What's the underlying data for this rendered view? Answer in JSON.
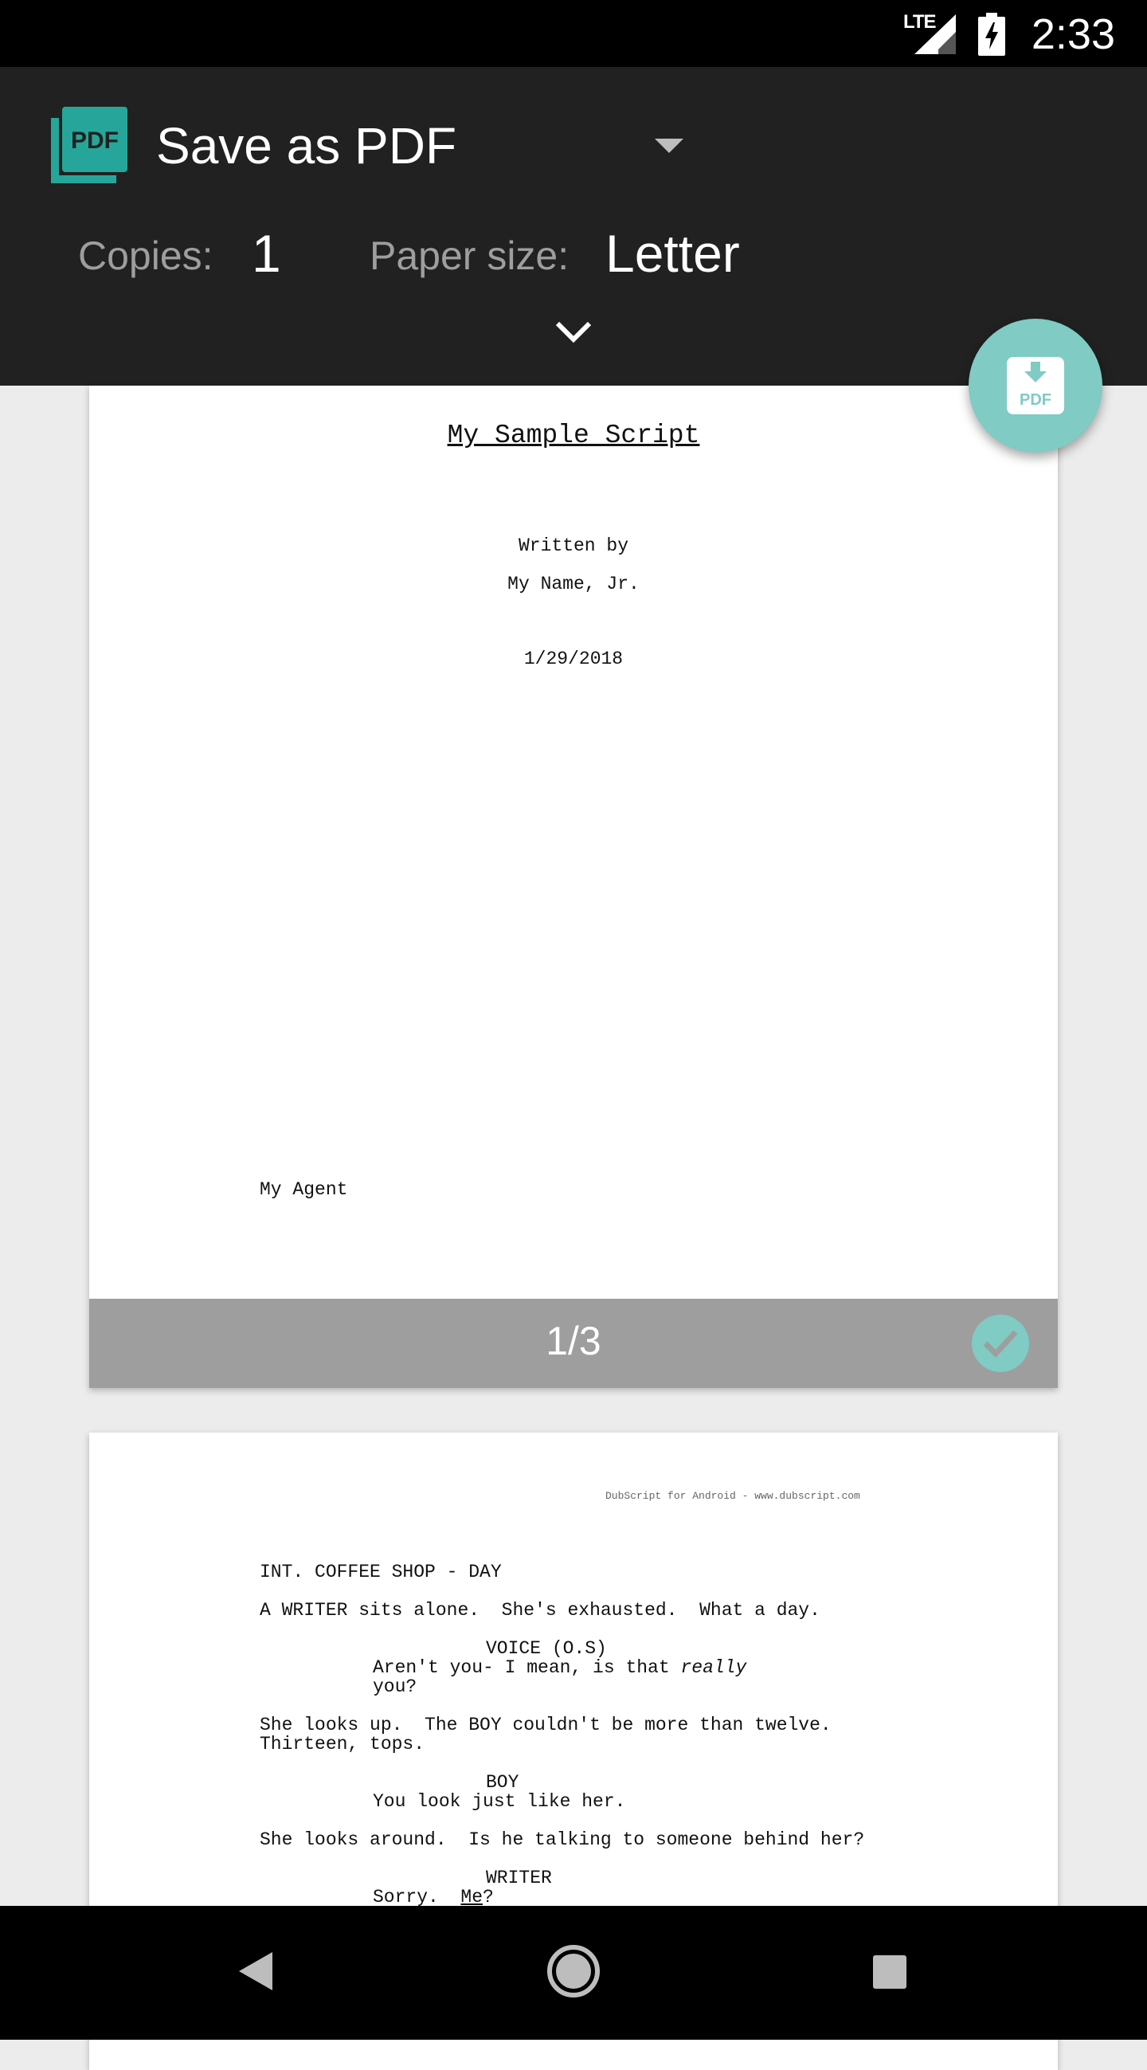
{
  "status_bar": {
    "time": "2:33",
    "network": "LTE"
  },
  "header": {
    "printer_name": "Save as PDF",
    "copies_label": "Copies:",
    "copies_value": "1",
    "paper_size_label": "Paper size:",
    "paper_size_value": "Letter"
  },
  "fab": {
    "icon": "pdf-download-icon",
    "color": "#80cbc4"
  },
  "page1": {
    "title": "My Sample Script",
    "written_by": "Written by",
    "author": "My Name, Jr.",
    "date": "1/29/2018",
    "agent": "My Agent",
    "page_number": "1/3"
  },
  "page2": {
    "watermark": "DubScript for Android - www.dubscript.com",
    "scene_heading": "INT. COFFEE SHOP - DAY",
    "action1": "A WRITER sits alone.  She's exhausted.  What a day.",
    "char1": "VOICE (O.S)",
    "dialogue1a": "Aren't you- I mean, is that ",
    "dialogue1_italic": "really",
    "dialogue1b": "you?",
    "action2a": "She looks up.  The BOY couldn't be more than twelve.",
    "action2b": "Thirteen, tops.",
    "char2": "BOY",
    "dialogue2": "You look just like her.",
    "action3": "She looks around.  Is he talking to someone behind her?",
    "char3": "WRITER",
    "dialogue3a": "Sorry.  ",
    "dialogue3_underline": "Me",
    "dialogue3b": "?"
  },
  "colors": {
    "header_bg": "#212121",
    "accent": "#80cbc4",
    "footer_bg": "#9e9e9e"
  }
}
